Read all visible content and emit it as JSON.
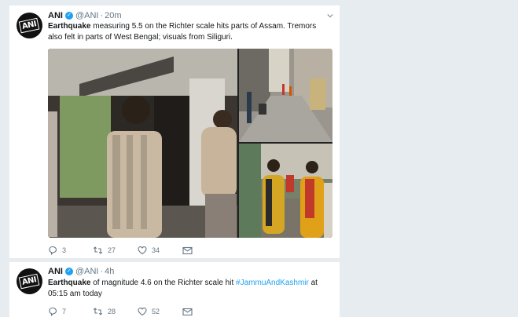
{
  "tweets": [
    {
      "name": "ANI",
      "handle": "@ANI",
      "separator": "·",
      "time": "20m",
      "avatar_text": "ANI",
      "text_bold": "Earthquake",
      "text_rest": " measuring 5.5 on the Richter scale hits parts of Assam. Tremors also felt in parts of West Bengal; visuals from Siliguri.",
      "replies": "3",
      "retweets": "27",
      "likes": "34"
    },
    {
      "name": "ANI",
      "handle": "@ANI",
      "separator": "·",
      "time": "4h",
      "avatar_text": "ANI",
      "text_bold": "Earthquake",
      "text_rest": " of magnitude 4.6 on the Richter scale hit ",
      "hashtag": "#JammuAndKashmir",
      "text_after": " at 05:15 am today",
      "replies": "7",
      "retweets": "28",
      "likes": "52"
    }
  ],
  "icons": [
    "verified-badge-icon",
    "chevron-down-icon",
    "reply-icon",
    "retweet-icon",
    "like-icon",
    "message-icon"
  ],
  "colors": {
    "accent": "#1da1f2",
    "text": "#14171a",
    "muted": "#657786",
    "background": "#e6ecf0"
  }
}
